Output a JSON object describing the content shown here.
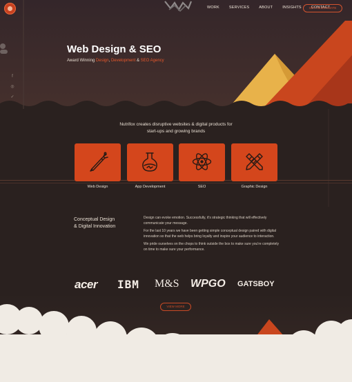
{
  "nav": {
    "items": [
      "WORK",
      "SERVICES",
      "ABOUT",
      "INSIGHTS",
      "CONTACT"
    ],
    "estimate_label": "GET AN ESTIMATE"
  },
  "hero": {
    "title": "Web Design & SEO",
    "subtitle_prefix": "Award Winning ",
    "subtitle_design": "Design",
    "subtitle_sep1": ", ",
    "subtitle_dev": "Development",
    "subtitle_sep2": " & ",
    "subtitle_seo": "SEO Agency",
    "social_icons": [
      "facebook-icon",
      "dribbble-icon",
      "twitter-icon"
    ]
  },
  "intro": {
    "line1": "Nutrifox creates disruptive websites & digital products for",
    "line2": "start-ups and growing brands"
  },
  "services": [
    {
      "label": "Web Design",
      "icon": "pencil-tool-icon"
    },
    {
      "label": "App Development",
      "icon": "flask-icon"
    },
    {
      "label": "SEO",
      "icon": "atom-icon"
    },
    {
      "label": "Graphic Design",
      "icon": "pencil-ruler-icon"
    }
  ],
  "about": {
    "heading_line1": "Conceptual Design",
    "heading_line2": "& Digital Innovation",
    "p1": "Design can evoke emotion. Successfully, it's strategic thinking that will effectively communicate your message.",
    "p2": "For the last 10 years we have been getting simple conceptual design paired with digital innovation so that the web helps bring loyalty and inspire your audience to interaction.",
    "p3": "We pride ourselves on the chops to think outside the box to make sure you're completely on time to make sure your performance."
  },
  "clients": [
    "acer",
    "IBM",
    "M&S",
    "WPGO",
    "GATSBOY"
  ],
  "more_label": "VIEW MORE",
  "colors": {
    "background": "#2a211f",
    "hero": "#3a2a28",
    "accent": "#d4461c",
    "mountain_yellow": "#e8b24a",
    "mountain_orange": "#c9461e",
    "cloud": "#f0ebe4"
  }
}
